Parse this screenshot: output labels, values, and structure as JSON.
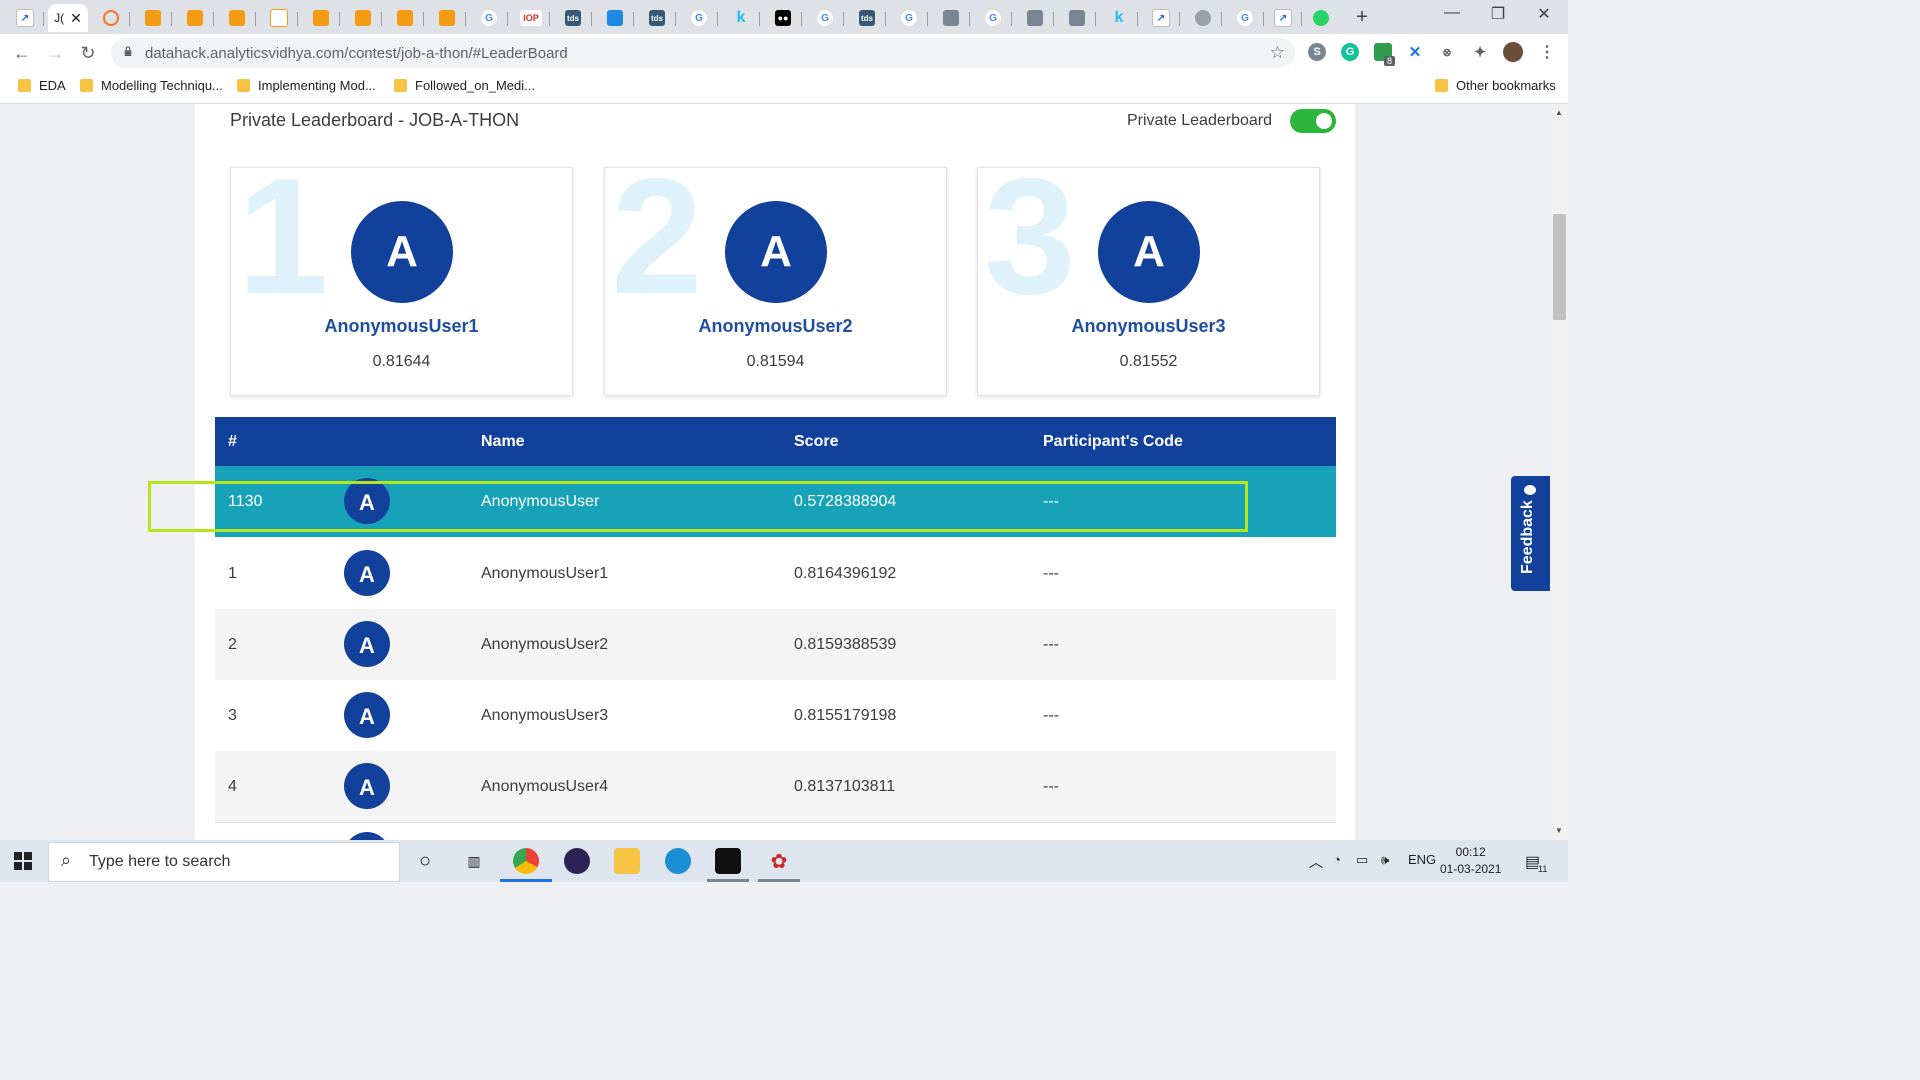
{
  "browser": {
    "active_tab_title": "J(",
    "url": "datahack.analyticsvidhya.com/contest/job-a-thon/#LeaderBoard",
    "bookmarks": [
      "EDA",
      "Modelling Techniqu...",
      "Implementing Mod...",
      "Followed_on_Medi..."
    ],
    "other_bookmarks": "Other bookmarks",
    "extension_badge": "8"
  },
  "page": {
    "title": "Private Leaderboard - JOB-A-THON",
    "toggle_label": "Private Leaderboard",
    "toggle_on": true,
    "podium": [
      {
        "rank": "1",
        "avatar": "A",
        "name": "AnonymousUser1",
        "score": "0.81644"
      },
      {
        "rank": "2",
        "avatar": "A",
        "name": "AnonymousUser2",
        "score": "0.81594"
      },
      {
        "rank": "3",
        "avatar": "A",
        "name": "AnonymousUser3",
        "score": "0.81552"
      }
    ],
    "table": {
      "headers": [
        "#",
        "Name",
        "Score",
        "Participant's Code"
      ],
      "rows": [
        {
          "rank": "1130",
          "avatar": "A",
          "name": "AnonymousUser",
          "score": "0.5728388904",
          "code": "---",
          "highlighted": true
        },
        {
          "rank": "1",
          "avatar": "A",
          "name": "AnonymousUser1",
          "score": "0.8164396192",
          "code": "---"
        },
        {
          "rank": "2",
          "avatar": "A",
          "name": "AnonymousUser2",
          "score": "0.8159388539",
          "code": "---"
        },
        {
          "rank": "3",
          "avatar": "A",
          "name": "AnonymousUser3",
          "score": "0.8155179198",
          "code": "---"
        },
        {
          "rank": "4",
          "avatar": "A",
          "name": "AnonymousUser4",
          "score": "0.8137103811",
          "code": "---"
        }
      ]
    },
    "feedback_label": "Feedback"
  },
  "taskbar": {
    "search_placeholder": "Type here to search",
    "language": "ENG",
    "time": "00:12",
    "date": "01-03-2021",
    "notification_count": "11"
  },
  "colors": {
    "brand_blue": "#12419b",
    "highlight_row": "#17a2b8",
    "annotation_box": "#b5e61d",
    "toggle_on": "#2bb53a"
  }
}
